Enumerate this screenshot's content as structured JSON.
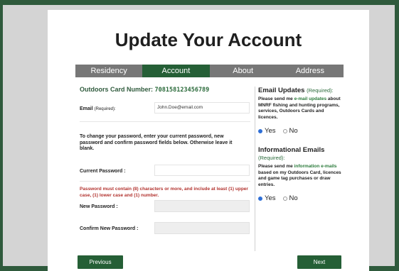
{
  "header": {
    "title": "Update Your Account"
  },
  "tabs": [
    {
      "label": "Residency",
      "active": false
    },
    {
      "label": "Account",
      "active": true
    },
    {
      "label": "About",
      "active": false
    },
    {
      "label": "Address",
      "active": false
    }
  ],
  "account": {
    "card_label": "Outdoors Card Number:",
    "card_number": "708158123456789",
    "email_label": "Email",
    "email_required": "(Required):",
    "email_value": "John.Doe@email.com",
    "password_instructions": "To change your password, enter your current password, new password and confirm password fields below. Otherwise leave it blank.",
    "current_password_label": "Current Password :",
    "current_password_value": "",
    "password_rule": "Password must contain (8) characters or more, and include at least (1) upper case, (1) lower case and (1) number.",
    "new_password_label": "New Password :",
    "new_password_value": "",
    "confirm_password_label": "Confirm New Password :",
    "confirm_password_value": ""
  },
  "email_updates": {
    "title": "Email Updates",
    "required": "(Required):",
    "text_pre": "Please send me ",
    "text_link": "e-mail updates",
    "text_post": " about MNRF fishing and hunting programs, services, Outdoors Cards and licences.",
    "yes_label": "Yes",
    "no_label": "No",
    "selected": "yes"
  },
  "informational_emails": {
    "title": "Informational Emails",
    "required": "(Required):",
    "text_pre": "Please send me ",
    "text_link": "information e-mails",
    "text_post": " based on my Outdoors Card, licences and game tag purchases or draw entries.",
    "yes_label": "Yes",
    "no_label": "No",
    "selected": "yes"
  },
  "nav": {
    "previous_label": "Previous",
    "next_label": "Next"
  },
  "colors": {
    "brand_green": "#255f36",
    "tab_inactive": "#777777",
    "warning": "#b2322e",
    "radio_selected": "#2f6fd6"
  }
}
